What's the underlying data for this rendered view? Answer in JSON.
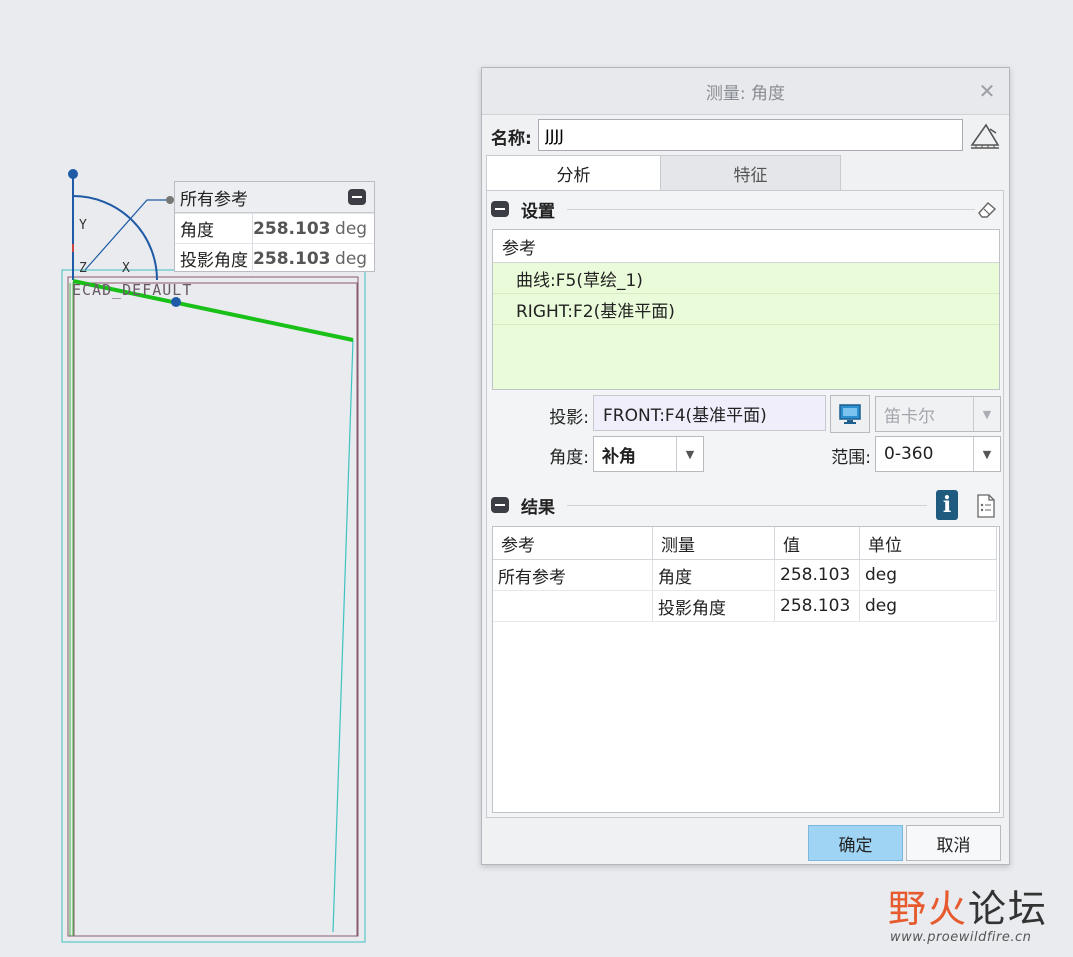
{
  "viewport": {
    "model_label": "ECAD_DEFAULT",
    "axis_labels": {
      "y": "Y",
      "z": "Z",
      "x": "X"
    }
  },
  "callout": {
    "title": "所有参考",
    "rows": [
      {
        "name": "角度",
        "value": "258.103",
        "unit": "deg"
      },
      {
        "name": "投影角度",
        "value": "258.103",
        "unit": "deg"
      }
    ]
  },
  "dialog": {
    "title": "测量: 角度",
    "name_label": "名称:",
    "name_value": "JJJJ",
    "tabs": [
      {
        "label": "分析"
      },
      {
        "label": "特征"
      }
    ],
    "settings": {
      "title": "设置",
      "references_header": "参考",
      "references": [
        "曲线:F5(草绘_1)",
        "RIGHT:F2(基准平面)"
      ],
      "projection_label": "投影:",
      "projection_value": "FRONT:F4(基准平面)",
      "coord_system_value": "笛卡尔",
      "angle_label": "角度:",
      "angle_value": "补角",
      "range_label": "范围:",
      "range_value": "0-360"
    },
    "results": {
      "title": "结果",
      "info_glyph": "i",
      "columns": [
        "参考",
        "测量",
        "值",
        "单位"
      ],
      "rows": [
        [
          "所有参考",
          "角度",
          "258.103",
          "deg"
        ],
        [
          "",
          "投影角度",
          "258.103",
          "deg"
        ]
      ]
    },
    "ok_label": "确定",
    "cancel_label": "取消"
  },
  "watermark": {
    "title_part1": "野",
    "title_part2": "火",
    "title_part3": "论坛",
    "url": "www.proewildfire.cn"
  },
  "colors": {
    "background": "#e9ebef",
    "highlight_line": "#18c018",
    "axis_blue": "#1f5aa6",
    "reference_bg": "#eafbd9",
    "ok_button": "#9fd4f4",
    "info_button": "#1e5b7f"
  }
}
